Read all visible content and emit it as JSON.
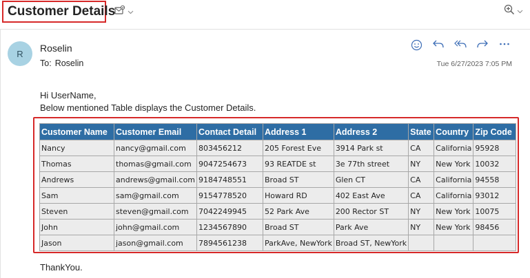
{
  "header": {
    "subject": "Customer Details"
  },
  "message": {
    "avatar_initial": "R",
    "sender": "Roselin",
    "to_label": "To:",
    "to_name": "Roselin",
    "timestamp": "Tue 6/27/2023 7:05 PM",
    "greeting": "Hi UserName,",
    "intro": "Below mentioned Table displays the Customer Details.",
    "closing": "ThankYou."
  },
  "icons": {
    "subject_actions": [
      "mark-read-icon",
      "chevron-down-icon"
    ],
    "zoom": [
      "zoom-icon",
      "chevron-down-icon"
    ],
    "message_actions": [
      "emoji-icon",
      "reply-icon",
      "reply-all-icon",
      "forward-icon",
      "more-icon"
    ]
  },
  "colors": {
    "header_bg": "#2e6da4",
    "cell_bg": "#ececec",
    "highlight_border": "#d62828",
    "avatar_bg": "#a8d2e3",
    "action_icon": "#3c6db6"
  },
  "table": {
    "columns": [
      "Customer Name",
      "Customer Email",
      "Contact Detail",
      "Address 1",
      "Address 2",
      "State",
      "Country",
      "Zip Code"
    ],
    "rows": [
      [
        "Nancy",
        "nancy@gmail.com",
        "803456212",
        "205 Forest Eve",
        "3914 Park st",
        "CA",
        "California",
        "95928"
      ],
      [
        "Thomas",
        "thomas@gmail.com",
        "9047254673",
        "93 REATDE st",
        "3e 77th street",
        "NY",
        "New York",
        "10032"
      ],
      [
        "Andrews",
        "andrews@gmail.com",
        "9184748551",
        "Broad ST",
        "Glen CT",
        "CA",
        "California",
        "94558"
      ],
      [
        "Sam",
        "sam@gmail.com",
        "9154778520",
        "Howard RD",
        "402 East Ave",
        "CA",
        "California",
        "93012"
      ],
      [
        "Steven",
        "steven@gmail.com",
        "7042249945",
        "52 Park Ave",
        "200 Rector ST",
        "NY",
        "New York",
        "10075"
      ],
      [
        "John",
        "john@gmail.com",
        "1234567890",
        "Broad ST",
        "Park Ave",
        "NY",
        "New York",
        "98456"
      ],
      [
        "Jason",
        "jason@gmail.com",
        "7894561238",
        "ParkAve, NewYork",
        "Broad ST, NewYork",
        "",
        "",
        ""
      ]
    ]
  }
}
